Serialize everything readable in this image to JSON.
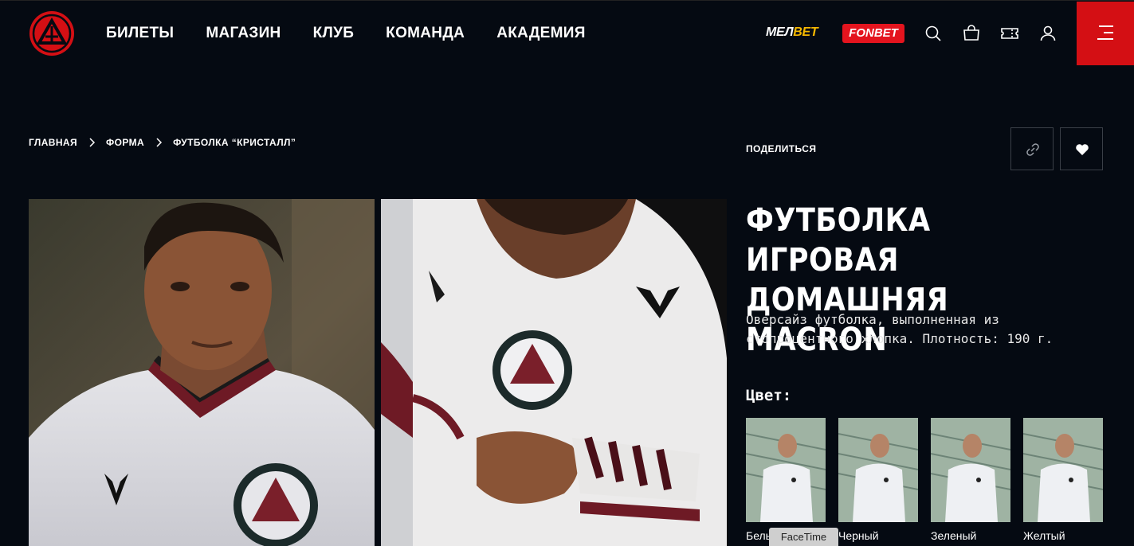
{
  "header": {
    "nav": [
      "БИЛЕТЫ",
      "МАГАЗИН",
      "КЛУБ",
      "КОМАНДА",
      "АКАДЕМИЯ"
    ],
    "sponsor_melbet_a": "МЕЛ",
    "sponsor_melbet_b": "BET",
    "sponsor_fonbet": "FONBET",
    "icons": [
      "search-icon",
      "bag-icon",
      "ticket-icon",
      "user-icon",
      "menu-icon"
    ],
    "accent": "#d40f14"
  },
  "breadcrumb": [
    "ГЛАВНАЯ",
    "ФОРМА",
    "ФУТБОЛКА “КРИСТАЛЛ”"
  ],
  "share": {
    "label": "ПОДЕЛИТЬСЯ"
  },
  "product": {
    "title": "ФУТБОЛКА ИГРОВАЯ ДОМАШНЯЯ MACRON",
    "description": "Оверсайз футболка, выполненная из стопроцентного хлопка. Плотность: 190 г.",
    "color_label": "Цвет:",
    "colors": [
      "Белый",
      "Черный",
      "Зеленый",
      "Желтый"
    ]
  },
  "overlay": {
    "facetime": "FaceTime"
  }
}
